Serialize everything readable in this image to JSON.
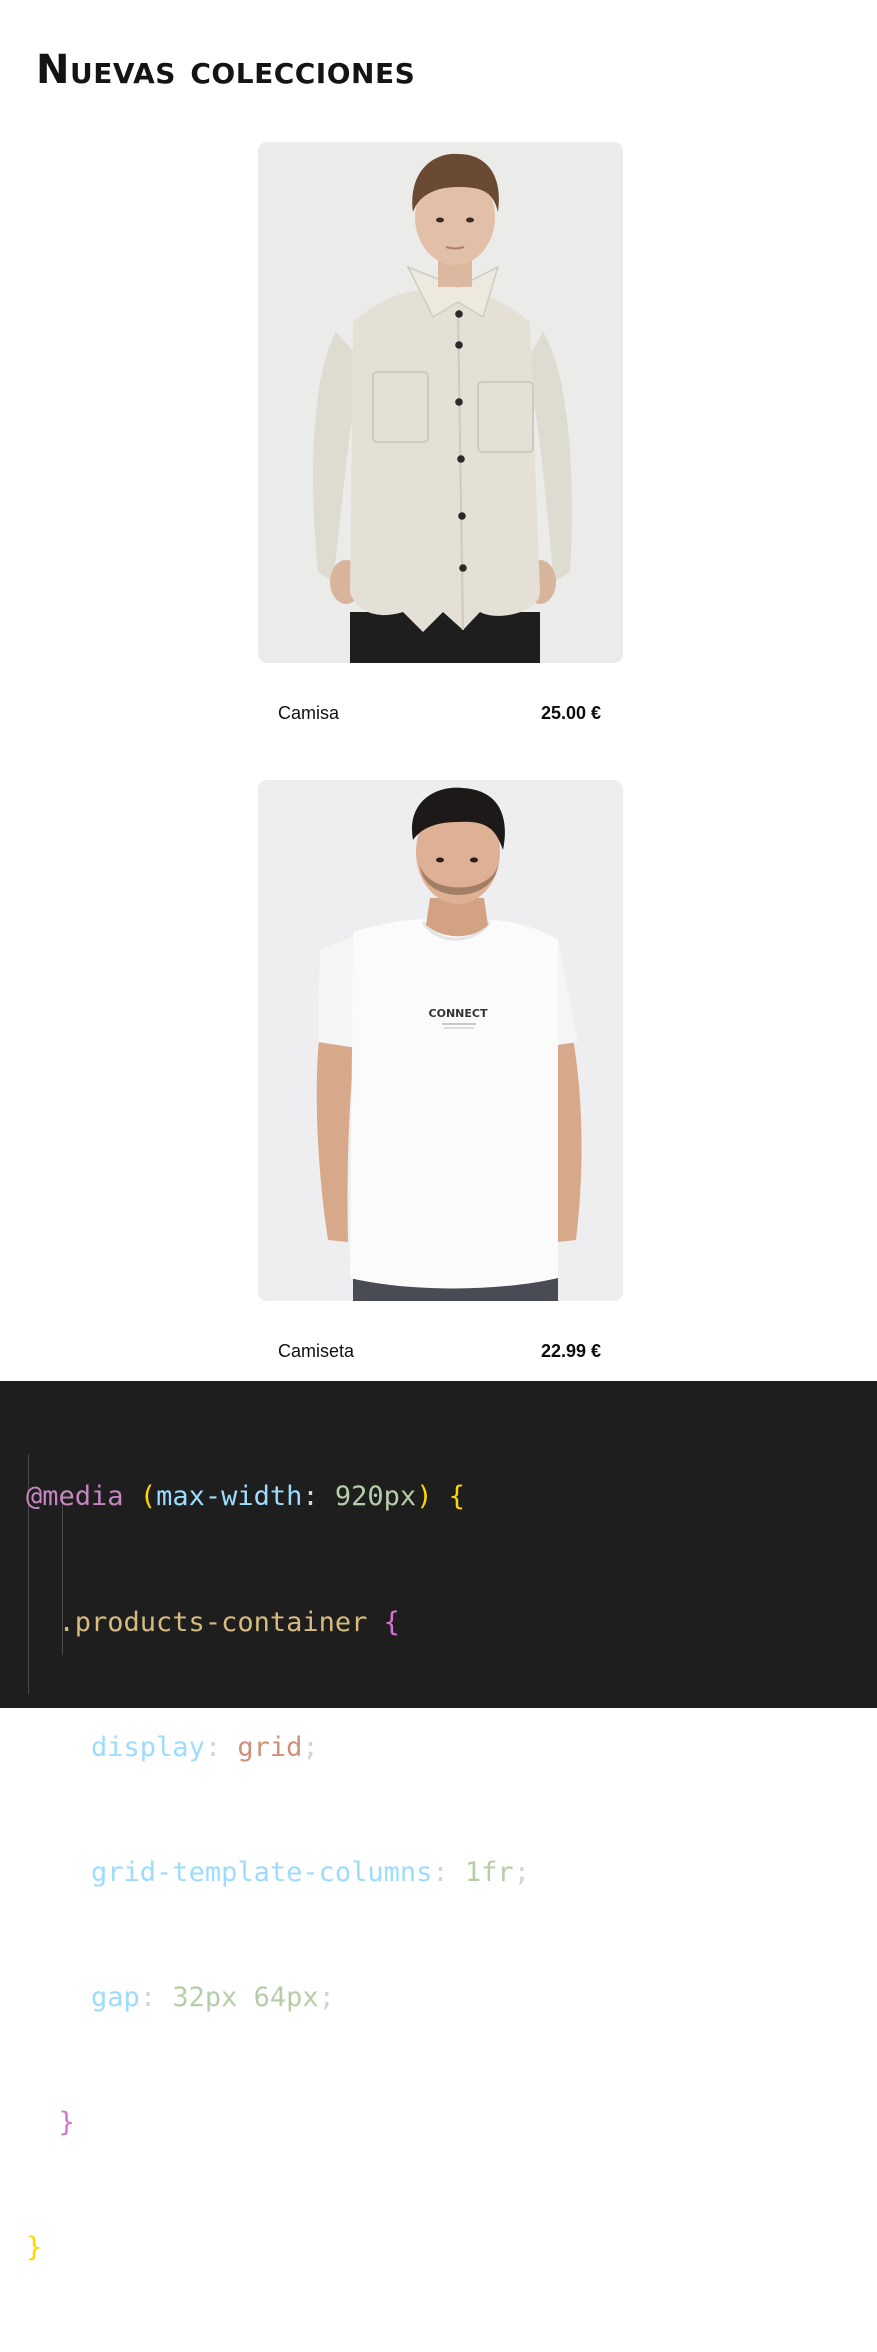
{
  "section": {
    "title": "Nuevas colecciones"
  },
  "products": [
    {
      "name": "Camisa",
      "price": "25.00 €",
      "image": "model-wearing-cream-button-up-shirt"
    },
    {
      "name": "Camiseta",
      "price": "22.99 €",
      "image": "model-wearing-white-tshirt",
      "shirt_print": "CONNECT"
    }
  ],
  "code": {
    "at_rule": "@media",
    "media_feature": "max-width",
    "media_value": "920px",
    "selector": ".products-container",
    "declarations": [
      {
        "property": "display",
        "value": "grid"
      },
      {
        "property": "grid-template-columns",
        "value": "1fr"
      },
      {
        "property": "gap",
        "value": "32px 64px"
      }
    ]
  },
  "colors": {
    "code_background": "#1e1e1e",
    "image_background": "#ebebea"
  }
}
